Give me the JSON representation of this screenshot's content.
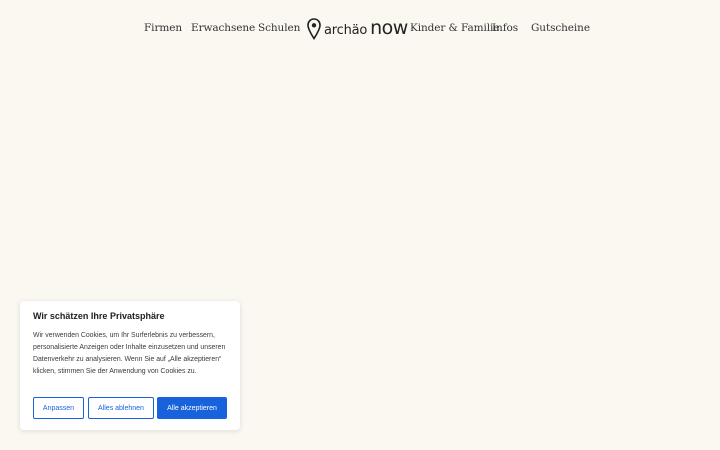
{
  "nav": {
    "left": [
      "Firmen",
      "Erwachsene",
      "Schulen"
    ],
    "right": [
      "Kinder & Familie",
      "Infos",
      "Gutscheine"
    ]
  },
  "logo": {
    "icon": "map-pin-icon",
    "part1": "archäo",
    "part2": "now"
  },
  "cookie": {
    "title": "Wir schätzen Ihre Privatsphäre",
    "text": "Wir verwenden Cookies, um Ihr Surferlebnis zu verbessern, personalisierte Anzeigen oder Inhalte einzusetzen und unseren Datenverkehr zu analysieren. Wenn Sie auf „Alle akzeptieren“ klicken, stimmen Sie der Anwendung von Cookies zu.",
    "buttons": {
      "customize": "Anpassen",
      "reject": "Alles ablehnen",
      "accept": "Alle akzeptieren"
    }
  },
  "colors": {
    "background": "#fbf8f2",
    "accent": "#1863dc",
    "text": "#333333"
  }
}
